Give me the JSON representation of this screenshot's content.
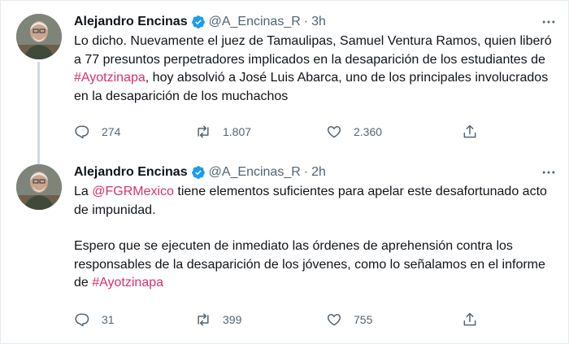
{
  "tweets": [
    {
      "author_name": "Alejandro Encinas",
      "handle": "@A_Encinas_R",
      "separator": "·",
      "time": "3h",
      "text_before": "Lo dicho. Nuevamente el juez de Tamaulipas, Samuel Ventura Ramos, quien liberó a 77 presuntos perpetradores implicados en la desaparición de los estudiantes de ",
      "hashtag": "#Ayotzinapa",
      "text_after": ", hoy absolvió a José Luis Abarca, uno de los principales involucrados en la desaparición de los muchachos",
      "replies": "274",
      "retweets": "1.807",
      "likes": "2.360"
    },
    {
      "author_name": "Alejandro Encinas",
      "handle": "@A_Encinas_R",
      "separator": "·",
      "time": "2h",
      "text_p1_before": "La ",
      "mention": "@FGRMexico",
      "text_p1_after": " tiene elementos suficientes para apelar este desafortunado acto de impunidad.",
      "text_p2_before": "Espero que se ejecuten de inmediato las órdenes de aprehensión contra los responsables de la desaparición de los jóvenes, como lo señalamos en el informe de ",
      "hashtag": "#Ayotzinapa",
      "replies": "31",
      "retweets": "399",
      "likes": "755"
    }
  ],
  "icons": {
    "verified": "verified-badge-icon",
    "more": "more-icon",
    "reply": "reply-icon",
    "retweet": "retweet-icon",
    "like": "heart-icon",
    "share": "share-icon"
  },
  "colors": {
    "link": "#d6306e",
    "verified": "#1d9bf0",
    "muted": "#536471",
    "thread_line": "#cfd9de"
  }
}
